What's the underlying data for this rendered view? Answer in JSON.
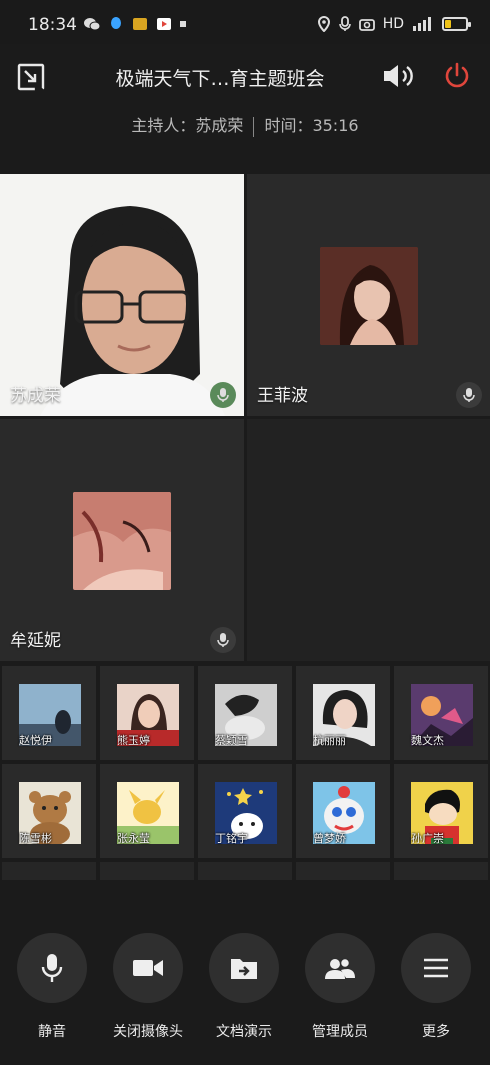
{
  "status_bar": {
    "time": "18:34",
    "network_label": "HD",
    "battery_level": 0.3
  },
  "header": {
    "title": "极端天气下…育主题班会",
    "host_label": "主持人：苏成荣",
    "time_label": "时间：35:16"
  },
  "main_tiles": [
    {
      "name": "苏成荣",
      "type": "camera"
    },
    {
      "name": "王菲波",
      "type": "avatar"
    },
    {
      "name": "牟延妮",
      "type": "avatar"
    }
  ],
  "participants_row1": [
    {
      "name": "赵悦伊"
    },
    {
      "name": "熊玉婷"
    },
    {
      "name": "蔡颖雪"
    },
    {
      "name": "杭丽丽"
    },
    {
      "name": "魏文杰"
    }
  ],
  "participants_row2": [
    {
      "name": "陈雪彬"
    },
    {
      "name": "张永莹"
    },
    {
      "name": "丁铭宇"
    },
    {
      "name": "曾梦娇"
    },
    {
      "name": "孙广崇"
    }
  ],
  "controls": [
    {
      "label": "静音",
      "icon": "mic-icon"
    },
    {
      "label": "关闭摄像头",
      "icon": "camera-icon"
    },
    {
      "label": "文档演示",
      "icon": "document-share-icon"
    },
    {
      "label": "管理成员",
      "icon": "members-icon"
    },
    {
      "label": "更多",
      "icon": "menu-icon"
    }
  ],
  "colors": {
    "background": "#1b1b1b",
    "tile_background": "#2a2a2a",
    "power_red": "#e0463c",
    "battery_yellow": "#f0c419"
  }
}
